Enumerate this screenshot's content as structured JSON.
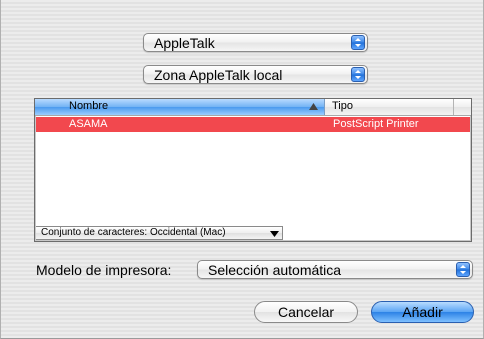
{
  "protocol_popup": {
    "value": "AppleTalk"
  },
  "zone_popup": {
    "value": "Zona AppleTalk local"
  },
  "printer_list": {
    "columns": [
      "Nombre",
      "Tipo"
    ],
    "rows": [
      {
        "name": "ASAMA",
        "type": "PostScript Printer",
        "selected": true
      }
    ]
  },
  "charset_popup": {
    "value": "Conjunto de caracteres: Occidental (Mac)"
  },
  "model": {
    "label": "Modelo de impresora:",
    "value": "Selección automática"
  },
  "buttons": {
    "cancel": "Cancelar",
    "add": "Añadir"
  },
  "colors": {
    "selection": "#f2484e",
    "accent_blue": "#3b86e6"
  }
}
